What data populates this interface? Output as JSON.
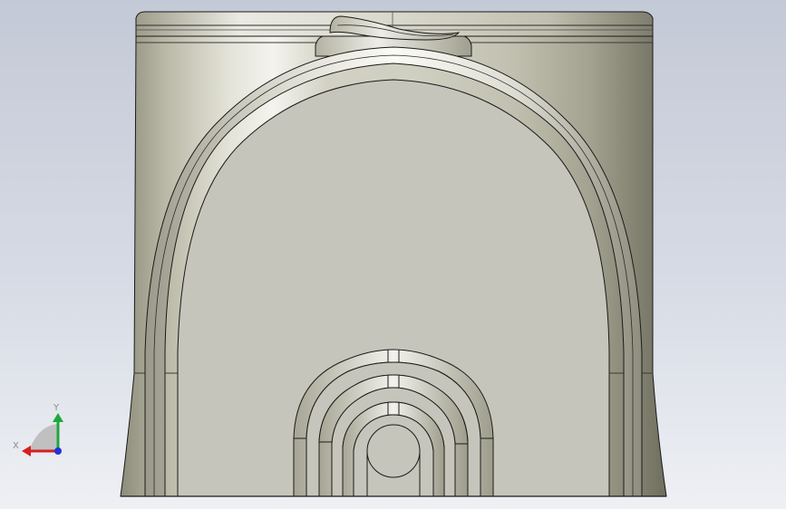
{
  "viewport": {
    "background_top": "#c3c9d6",
    "background_bottom": "#eef0f4"
  },
  "model": {
    "kind": "3d-part-front-view",
    "face_color": "#c5c5bb",
    "edge_color": "#1a1a1a"
  },
  "triad": {
    "x_label": "X",
    "y_label": "Y",
    "x_axis_color": "#d42020",
    "y_axis_color": "#1fa83a",
    "z_axis_color": "#2033d8"
  }
}
